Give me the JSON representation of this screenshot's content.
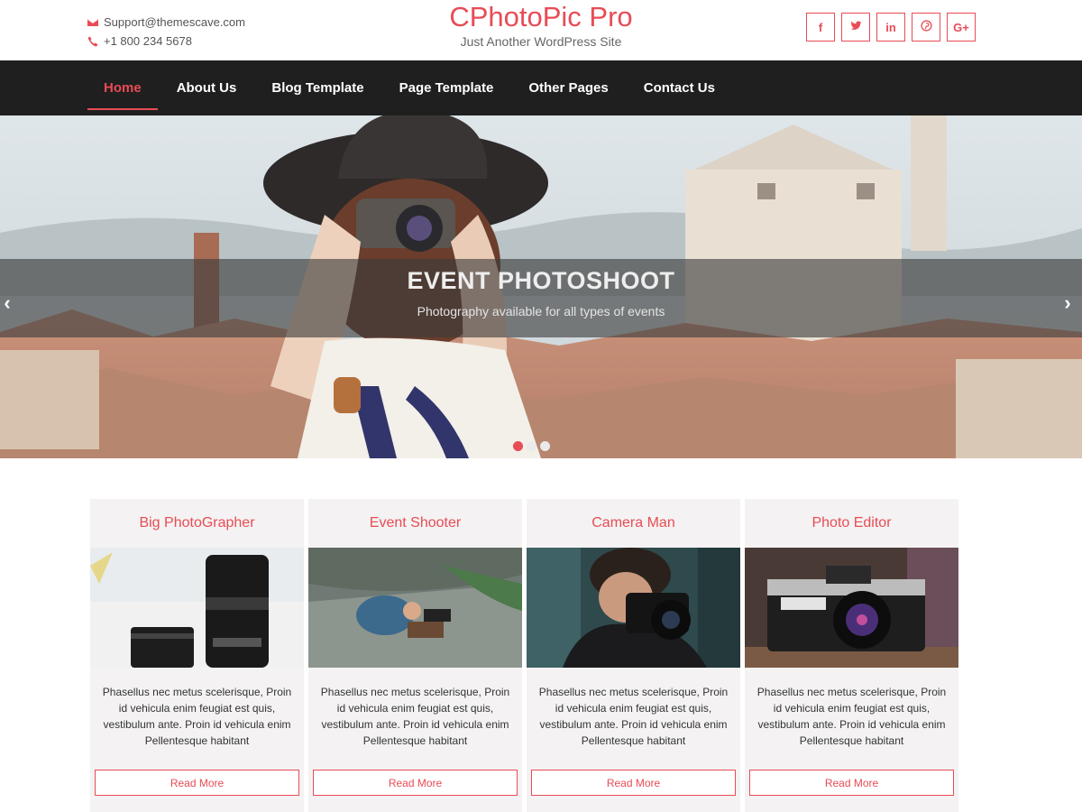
{
  "header": {
    "email": "Support@themescave.com",
    "phone": "+1 800 234 5678",
    "site_title": "CPhotoPic Pro",
    "tagline": "Just Another WordPress Site",
    "social": [
      {
        "icon": "facebook-icon",
        "glyph": "f"
      },
      {
        "icon": "twitter-icon",
        "glyph": ""
      },
      {
        "icon": "linkedin-icon",
        "glyph": "in"
      },
      {
        "icon": "pinterest-icon",
        "glyph": ""
      },
      {
        "icon": "google-plus-icon",
        "glyph": "G+"
      }
    ]
  },
  "nav": {
    "items": [
      {
        "label": "Home",
        "active": true
      },
      {
        "label": "About Us"
      },
      {
        "label": "Blog Template"
      },
      {
        "label": "Page Template"
      },
      {
        "label": "Other Pages"
      },
      {
        "label": "Contact Us"
      }
    ]
  },
  "slider": {
    "title": "EVENT PHOTOSHOOT",
    "subtitle": "Photography available for all types of events",
    "prev_glyph": "‹",
    "next_glyph": "›",
    "slide_count": 3,
    "active_slide": 1
  },
  "cards": [
    {
      "title": "Big PhotoGrapher",
      "text": "Phasellus nec metus scelerisque, Proin id vehicula enim feugiat est quis, vestibulum ante. Proin id vehicula enim Pellentesque habitant",
      "button": "Read More"
    },
    {
      "title": "Event Shooter",
      "text": "Phasellus nec metus scelerisque, Proin id vehicula enim feugiat est quis, vestibulum ante. Proin id vehicula enim Pellentesque habitant",
      "button": "Read More"
    },
    {
      "title": "Camera Man",
      "text": "Phasellus nec metus scelerisque, Proin id vehicula enim feugiat est quis, vestibulum ante. Proin id vehicula enim Pellentesque habitant",
      "button": "Read More"
    },
    {
      "title": "Photo Editor",
      "text": "Phasellus nec metus scelerisque, Proin id vehicula enim feugiat est quis, vestibulum ante. Proin id vehicula enim Pellentesque habitant",
      "button": "Read More"
    }
  ],
  "colors": {
    "accent": "#e84c55",
    "nav_bg": "#1f1f1f",
    "card_bg": "#f4f2f2"
  }
}
